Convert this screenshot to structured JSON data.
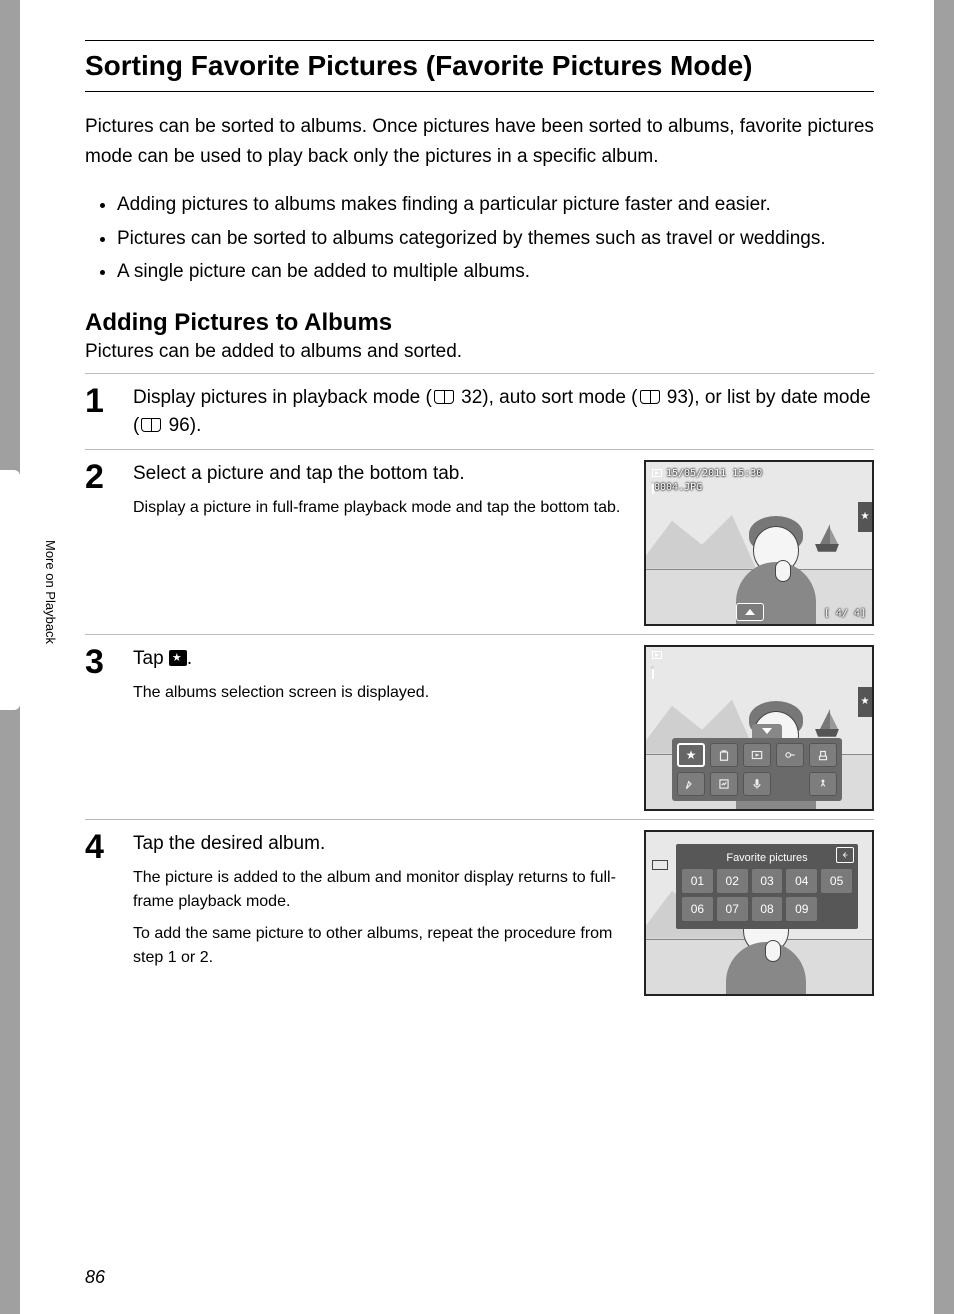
{
  "page_title": "Sorting Favorite Pictures (Favorite Pictures Mode)",
  "intro": "Pictures can be sorted to albums. Once pictures have been sorted to albums, favorite pictures mode can be used to play back only the pictures in a specific album.",
  "bullets": [
    "Adding pictures to albums makes finding a particular picture faster and easier.",
    "Pictures can be sorted to albums categorized by themes such as travel or weddings.",
    "A single picture can be added to multiple albums."
  ],
  "subheading": "Adding Pictures to Albums",
  "subdesc": "Pictures can be added to albums and sorted.",
  "steps": {
    "s1": {
      "num": "1",
      "text_a": "Display pictures in playback mode (",
      "ref1": " 32), auto sort mode (",
      "ref2": " 93), or list by date mode (",
      "ref3": " 96)."
    },
    "s2": {
      "num": "2",
      "title": "Select a picture and tap the bottom tab.",
      "sub": "Display a picture in full-frame playback mode and tap the bottom tab."
    },
    "s3": {
      "num": "3",
      "title_a": "Tap ",
      "title_b": ".",
      "sub": "The albums selection screen is displayed."
    },
    "s4": {
      "num": "4",
      "title": "Tap the desired album.",
      "sub1": "The picture is added to the album and monitor display returns to full-frame playback mode.",
      "sub2": "To add the same picture to other albums, repeat the procedure from step 1 or 2."
    }
  },
  "lcd2": {
    "date": "15/05/2011 15:30",
    "file": "0004.JPG",
    "counter": "[   4/   4]"
  },
  "lcd4": {
    "title": "Favorite pictures",
    "cells": [
      "01",
      "02",
      "03",
      "04",
      "05",
      "06",
      "07",
      "08",
      "09"
    ]
  },
  "sidebar": "More on Playback",
  "page_number": "86"
}
